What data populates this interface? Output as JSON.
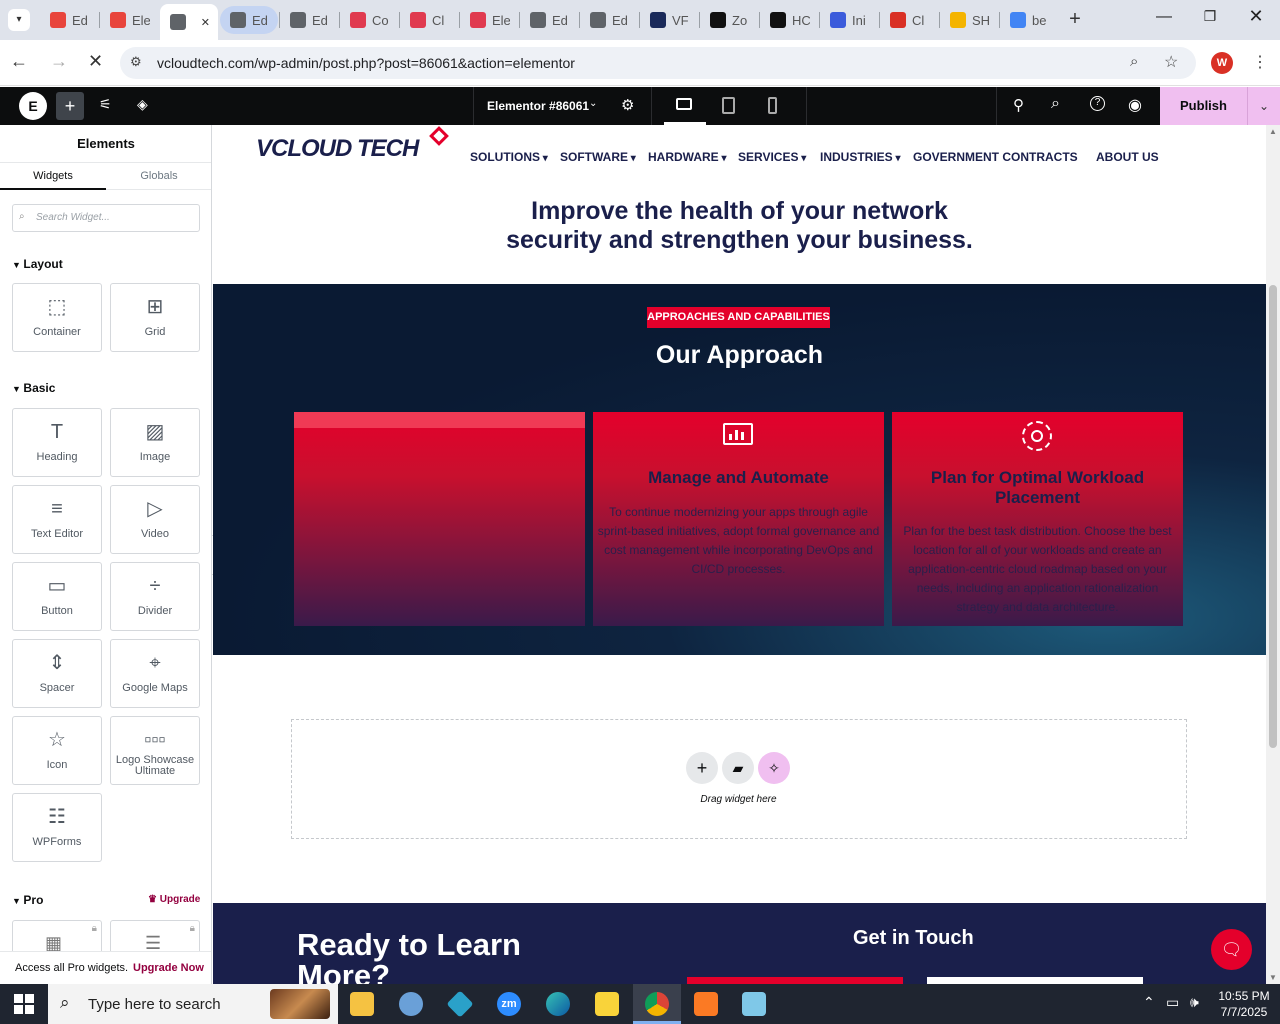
{
  "browser": {
    "tabs": [
      {
        "label": "Ed",
        "color": "#e8453c"
      },
      {
        "label": "Ele",
        "color": "#e8453c"
      },
      {
        "label": "",
        "color": "#5f6368"
      },
      {
        "label": "Ed",
        "color": "#5f6368"
      },
      {
        "label": "Ed",
        "color": "#5f6368"
      },
      {
        "label": "Co",
        "color": "#e03a4f"
      },
      {
        "label": "Cl",
        "color": "#e03a4f"
      },
      {
        "label": "Ele",
        "color": "#e03a4f"
      },
      {
        "label": "Ed",
        "color": "#5f6368"
      },
      {
        "label": "Ed",
        "color": "#5f6368"
      },
      {
        "label": "VF",
        "color": "#1a2a5a"
      },
      {
        "label": "Zo",
        "color": "#111111"
      },
      {
        "label": "HC",
        "color": "#111111"
      },
      {
        "label": "Ini",
        "color": "#3b5bdb"
      },
      {
        "label": "Cl",
        "color": "#d93025"
      },
      {
        "label": "SH",
        "color": "#f4b400"
      },
      {
        "label": "be",
        "color": "#4285f4"
      }
    ],
    "url": "vcloudtech.com/wp-admin/post.php?post=86061&action=elementor",
    "profile_initial": "W"
  },
  "editor": {
    "document_title": "Elementor #86061",
    "publish_label": "Publish"
  },
  "panel": {
    "title": "Elements",
    "tabs": [
      "Widgets",
      "Globals"
    ],
    "search_placeholder": "Search Widget...",
    "layout_title": "Layout",
    "layout_widgets": [
      {
        "label": "Container",
        "icon": "container-icon"
      },
      {
        "label": "Grid",
        "icon": "grid-icon"
      }
    ],
    "basic_title": "Basic",
    "basic_widgets": [
      {
        "label": "Heading",
        "icon": "heading-icon"
      },
      {
        "label": "Image",
        "icon": "image-icon"
      },
      {
        "label": "Text Editor",
        "icon": "text-editor-icon"
      },
      {
        "label": "Video",
        "icon": "video-icon"
      },
      {
        "label": "Button",
        "icon": "button-icon"
      },
      {
        "label": "Divider",
        "icon": "divider-icon"
      },
      {
        "label": "Spacer",
        "icon": "spacer-icon"
      },
      {
        "label": "Google Maps",
        "icon": "google-maps-icon"
      },
      {
        "label": "Icon",
        "icon": "star-icon"
      },
      {
        "label": "Logo Showcase Ultimate",
        "icon": "logo-showcase-icon"
      },
      {
        "label": "WPForms",
        "icon": "wpforms-icon"
      }
    ],
    "pro_title": "Pro",
    "upgrade_label": "Upgrade",
    "promo_text": "Access all Pro widgets.",
    "promo_link": "Upgrade Now"
  },
  "site": {
    "logo_text": "VCLOUD TECH",
    "nav": [
      {
        "label": "SOLUTIONS",
        "dropdown": true
      },
      {
        "label": "SOFTWARE",
        "dropdown": true
      },
      {
        "label": "HARDWARE",
        "dropdown": true
      },
      {
        "label": "SERVICES",
        "dropdown": true
      },
      {
        "label": "INDUSTRIES",
        "dropdown": true
      },
      {
        "label": "GOVERNMENT CONTRACTS",
        "dropdown": false
      },
      {
        "label": "ABOUT US",
        "dropdown": false
      }
    ],
    "headline_line1": "Improve the health of your network",
    "headline_line2": "security and strengthen your business.",
    "approach_badge": "APPROACHES AND CAPABILITIES",
    "approach_title": "Our Approach",
    "cards": [
      {
        "title": "",
        "text": "",
        "icon": ""
      },
      {
        "title": "Manage and Automate",
        "text": "To continue modernizing your apps through agile sprint-based initiatives, adopt formal governance and cost management while incorporating DevOps and CI/CD processes.",
        "icon": "monitor-chart-icon"
      },
      {
        "title": "Plan for Optimal Workload Placement",
        "text": "Plan for the best task distribution. Choose the best location for all of your workloads and create an application-centric cloud roadmap based on your needs, including an application rationalization strategy and data architecture.",
        "icon": "gear-cloud-icon"
      }
    ],
    "drop_hint": "Drag widget here",
    "footer_title_line1": "Ready to Learn",
    "footer_title_line2": "More?",
    "footer_contact": "Get in Touch"
  },
  "taskbar": {
    "search_placeholder": "Type here to search",
    "time": "10:55 PM",
    "date": "7/7/2025"
  },
  "colors": {
    "brand_red": "#e4002b",
    "navy": "#1a1f4b",
    "editor_bar": "#0c0d0e",
    "publish_bg": "#f0bff0"
  }
}
